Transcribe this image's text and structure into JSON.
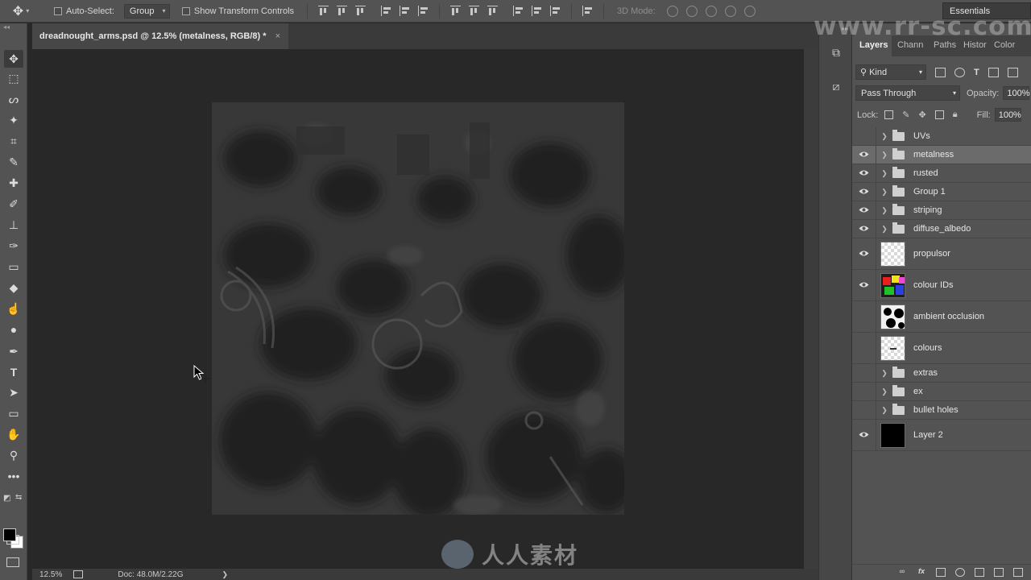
{
  "options_bar": {
    "auto_select_label": "Auto-Select:",
    "auto_select_value": "Group",
    "show_transform_label": "Show Transform Controls",
    "mode_3d_label": "3D Mode:",
    "workspace": "Essentials"
  },
  "document": {
    "tab_title": "dreadnought_arms.psd @ 12.5% (metalness, RGB/8) *",
    "close_glyph": "×"
  },
  "status": {
    "zoom": "12.5%",
    "doc_info": "Doc: 48.0M/2.22G",
    "arrow": "❯"
  },
  "panel_tabs": [
    "Layers",
    "Chann",
    "Paths",
    "Histor",
    "Color"
  ],
  "layers_panel": {
    "filter_kind": "Kind",
    "blend_mode": "Pass Through",
    "opacity_label": "Opacity:",
    "opacity_value": "100%",
    "lock_label": "Lock:",
    "fill_label": "Fill:",
    "fill_value": "100%"
  },
  "layers": [
    {
      "name": "UVs",
      "type": "group",
      "visible": false
    },
    {
      "name": "metalness",
      "type": "group",
      "visible": true,
      "selected": true
    },
    {
      "name": "rusted",
      "type": "group",
      "visible": true
    },
    {
      "name": "Group 1",
      "type": "group",
      "visible": true
    },
    {
      "name": "striping",
      "type": "group",
      "visible": true
    },
    {
      "name": "diffuse_albedo",
      "type": "group",
      "visible": true
    },
    {
      "name": "propulsor",
      "type": "pixel",
      "visible": true,
      "thumb": "checker"
    },
    {
      "name": "colour IDs",
      "type": "pixel",
      "visible": true,
      "thumb": "ids"
    },
    {
      "name": "ambient occlusion",
      "type": "pixel",
      "visible": false,
      "thumb": "ao"
    },
    {
      "name": "colours",
      "type": "pixel",
      "visible": false,
      "thumb": "checker"
    },
    {
      "name": "extras",
      "type": "group",
      "visible": false
    },
    {
      "name": "ex",
      "type": "group",
      "visible": false
    },
    {
      "name": "bullet holes",
      "type": "group",
      "visible": false
    },
    {
      "name": "Layer 2",
      "type": "pixel",
      "visible": true,
      "thumb": "black"
    }
  ],
  "tools": [
    "move-tool",
    "marquee-tool",
    "lasso-tool",
    "magic-wand-tool",
    "crop-tool",
    "eyedropper-tool",
    "healing-brush-tool",
    "brush-tool",
    "clone-stamp-tool",
    "history-brush-tool",
    "eraser-tool",
    "paint-bucket-tool",
    "smudge-tool",
    "dodge-tool",
    "pen-tool",
    "type-tool",
    "path-selection-tool",
    "rectangle-tool",
    "hand-tool",
    "zoom-tool",
    "more-tools"
  ],
  "tool_glyphs": [
    "✥",
    "⬚",
    "ᔕ",
    "✦",
    "⌗",
    "✎",
    "✚",
    "✐",
    "⊥",
    "✑",
    "▭",
    "◆",
    "☝",
    "●",
    "✒",
    "T",
    "➤",
    "▭",
    "✋",
    "⚲",
    "•••"
  ],
  "watermark": {
    "top": "www.rr-sc.com",
    "bottom": "人人素材"
  },
  "colors": {
    "foreground": "#000000",
    "background": "#ffffff",
    "selected_layer": "#6b6b6b"
  }
}
